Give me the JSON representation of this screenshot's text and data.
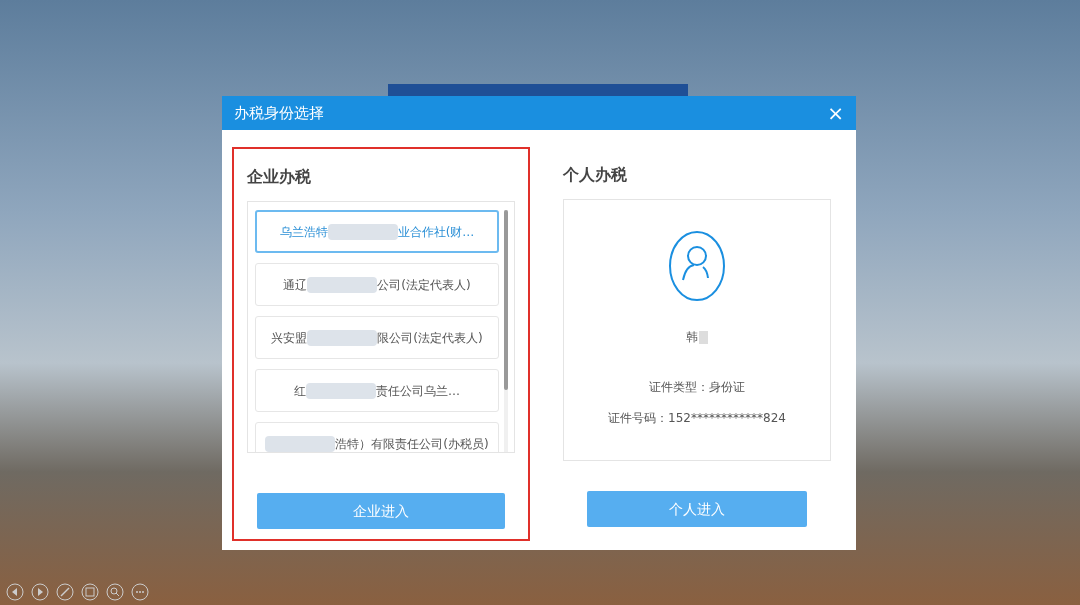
{
  "dialog": {
    "title": "办税身份选择",
    "close": "×"
  },
  "enterprise": {
    "heading": "企业办税",
    "highlighted": true,
    "items": [
      {
        "parts": [
          "乌兰浩特",
          "业合作社(财…"
        ],
        "selected": true
      },
      {
        "parts": [
          "通辽",
          "公司(法定代表人)"
        ],
        "selected": false
      },
      {
        "parts": [
          "兴安盟",
          "限公司(法定代表人)"
        ],
        "selected": false
      },
      {
        "parts": [
          "红",
          "责任公司乌兰…"
        ],
        "selected": false
      },
      {
        "redacted_start": true,
        "parts": [
          "浩特）有限责任公司(办税员)"
        ],
        "selected": false
      }
    ],
    "button": "企业进入"
  },
  "personal": {
    "heading": "个人办税",
    "name": "韩",
    "id_type": "证件类型：身份证",
    "id_number": "证件号码：152************824",
    "button": "个人进入"
  }
}
